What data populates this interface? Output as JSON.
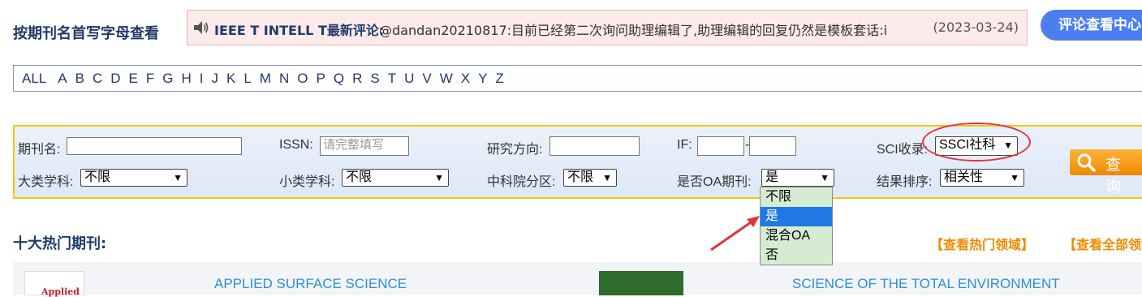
{
  "header": {
    "title": "按期刊名首写字母查看",
    "notice_title": "IEEE T INTELL T最新评论:",
    "notice_body": "@dandan20210817:目前已经第二次询问助理编辑了,助理编辑的回复仍然是模板套话:i",
    "notice_date": "(2023-03-24)",
    "review_button": "评论查看中心"
  },
  "letters": [
    "ALL",
    "A",
    "B",
    "C",
    "D",
    "E",
    "F",
    "G",
    "H",
    "I",
    "J",
    "K",
    "L",
    "M",
    "N",
    "O",
    "P",
    "Q",
    "R",
    "S",
    "T",
    "U",
    "V",
    "W",
    "X",
    "Y",
    "Z"
  ],
  "search": {
    "journal_name_label": "期刊名:",
    "issn_label": "ISSN:",
    "issn_placeholder": "请完整填写",
    "research_label": "研究方向:",
    "if_label": "IF:",
    "if_separator": "-",
    "sci_label": "SCI收录:",
    "sci_value": "SSCI社科",
    "major_label": "大类学科:",
    "major_value": "不限",
    "minor_label": "小类学科:",
    "minor_value": "不限",
    "cas_label": "中科院分区:",
    "cas_value": "不限",
    "oa_label": "是否OA期刊:",
    "oa_value": "是",
    "sort_label": "结果排序:",
    "sort_value": "相关性",
    "search_button": "查 询",
    "oa_options": [
      "不限",
      "是",
      "混合OA",
      "否"
    ]
  },
  "hot": {
    "title": "十大热门期刊:",
    "view_hot_fields": "【查看热门领域】",
    "view_all": "【查看全部领域】",
    "journals": [
      "APPLIED SURFACE SCIENCE",
      "SCIENCE OF THE TOTAL ENVIRONMENT"
    ],
    "cover1_text": "Applied"
  },
  "colors": {
    "accent": "#1f3a6b",
    "link": "#2f8fd8",
    "orange": "#f08a00",
    "annotation_red": "#e0353d"
  }
}
